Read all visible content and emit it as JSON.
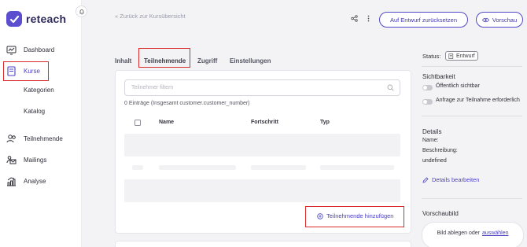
{
  "brand": {
    "name": "reteach",
    "color": "#5b4fd0"
  },
  "sidebar": {
    "items": [
      {
        "label": "Dashboard",
        "icon": "dashboard-icon"
      },
      {
        "label": "Kurse",
        "icon": "book-icon",
        "active": true
      },
      {
        "label": "Kategorien"
      },
      {
        "label": "Katalog"
      },
      {
        "label": "Teilnehmende",
        "icon": "users-icon"
      },
      {
        "label": "Mailings",
        "icon": "mail-icon"
      },
      {
        "label": "Analyse",
        "icon": "chart-icon"
      }
    ]
  },
  "header": {
    "back": "Zurück zur Kursübersicht",
    "reset_label": "Auf Entwurf zurücksetzen",
    "preview_label": "Vorschau"
  },
  "tabs": [
    "Inhalt",
    "Teilnehmende",
    "Zugriff",
    "Einstellungen"
  ],
  "participants": {
    "search_placeholder": "Teilnehmer filtern",
    "count_text": "0 Einträge (Insgesamt customer.customer_number)",
    "columns": [
      "Name",
      "Fortschritt",
      "Typ"
    ],
    "add_label": "Teilnehmende hinzufügen"
  },
  "right_panel": {
    "status_label": "Status:",
    "status_value": "Entwurf",
    "visibility_heading": "Sichtbarkeit",
    "toggle_public": "Öffentlich sichtbar",
    "toggle_request": "Anfrage zur Teilnahme erforderlich",
    "details_heading": "Details",
    "name_label": "Name:",
    "description_label": "Beschreibung:",
    "description_value": "undefined",
    "edit_details": "Details bearbeiten",
    "preview_image_heading": "Vorschaubild",
    "drop_text": "Bild ablegen oder",
    "drop_link": "auswählen"
  },
  "colors": {
    "accent": "#4a40c4",
    "highlight": "#d92b2b"
  }
}
